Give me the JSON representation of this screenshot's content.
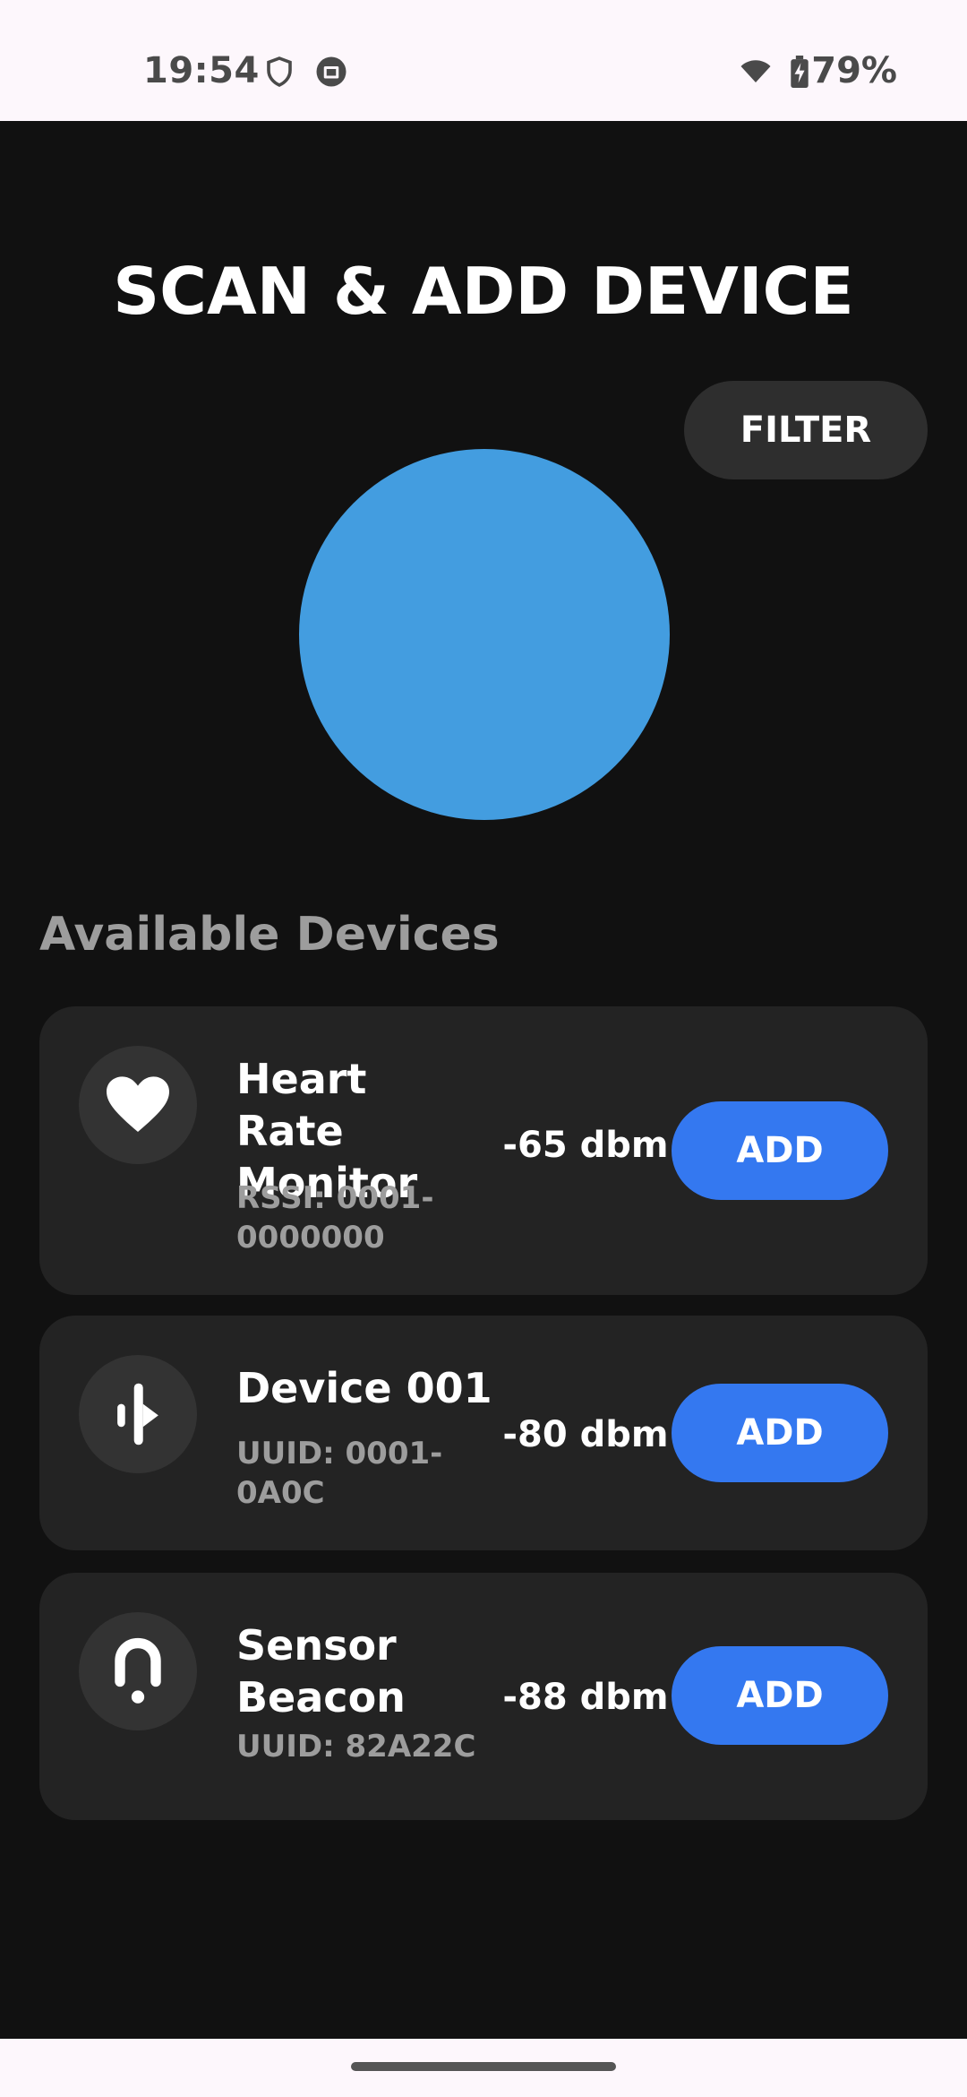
{
  "status_bar": {
    "time": "19:54",
    "battery": "79%",
    "icons": [
      "shield-icon",
      "media-icon",
      "wifi-icon",
      "battery-charging-icon"
    ]
  },
  "page": {
    "title": "SCAN & ADD DEVICE",
    "filter_label": "FILTER",
    "section_label": "Available Devices",
    "accent_color": "#439de0",
    "button_color": "#3478f0"
  },
  "devices": [
    {
      "name": "Heart Rate Monitor",
      "sub": "RSSI: 0001-0000000",
      "rssi": "-65 dbm",
      "add_label": "ADD",
      "icon": "heart-icon"
    },
    {
      "name": "Device 001",
      "sub": "UUID: 0001-0A0C",
      "rssi": "-80 dbm",
      "add_label": "ADD",
      "icon": "bluetooth-device-icon"
    },
    {
      "name": "Sensor Beacon",
      "sub": "UUID: 82A22C",
      "rssi": "-88 dbm",
      "add_label": "ADD",
      "icon": "beacon-icon"
    }
  ]
}
